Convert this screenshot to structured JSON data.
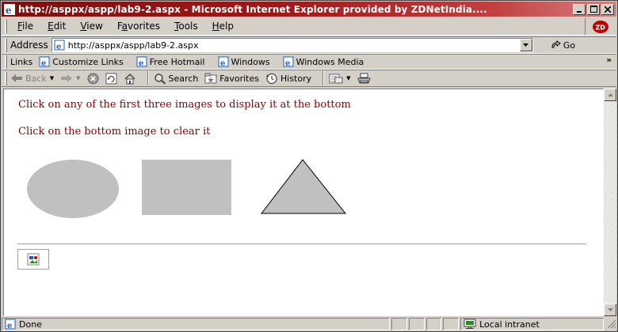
{
  "window": {
    "title": "http://asppx/aspp/lab9-2.aspx - Microsoft Internet Explorer provided by ZDNetIndia...."
  },
  "menu": {
    "items": [
      {
        "label": "File",
        "ul": "F"
      },
      {
        "label": "Edit",
        "ul": "E"
      },
      {
        "label": "View",
        "ul": "V"
      },
      {
        "label": "Favorites",
        "ul": "a"
      },
      {
        "label": "Tools",
        "ul": "T"
      },
      {
        "label": "Help",
        "ul": "H"
      }
    ],
    "brand_logo": "ZD"
  },
  "address": {
    "label": "Address",
    "url": "http://asppx/aspp/lab9-2.aspx",
    "go_label": "Go"
  },
  "links": {
    "label": "Links",
    "items": [
      "Customize Links",
      "Free Hotmail",
      "Windows",
      "Windows Media"
    ],
    "more": "»"
  },
  "toolbar": {
    "back_label": "Back",
    "search_label": "Search",
    "favorites_label": "Favorites",
    "history_label": "History"
  },
  "page": {
    "line1": "Click on any of the first three images to display it at the bottom",
    "line2": "Click on the bottom image to clear it",
    "shape_color": "#c0c0c0",
    "text_color": "#8b0000"
  },
  "status": {
    "text": "Done",
    "zone": "Local intranet"
  }
}
